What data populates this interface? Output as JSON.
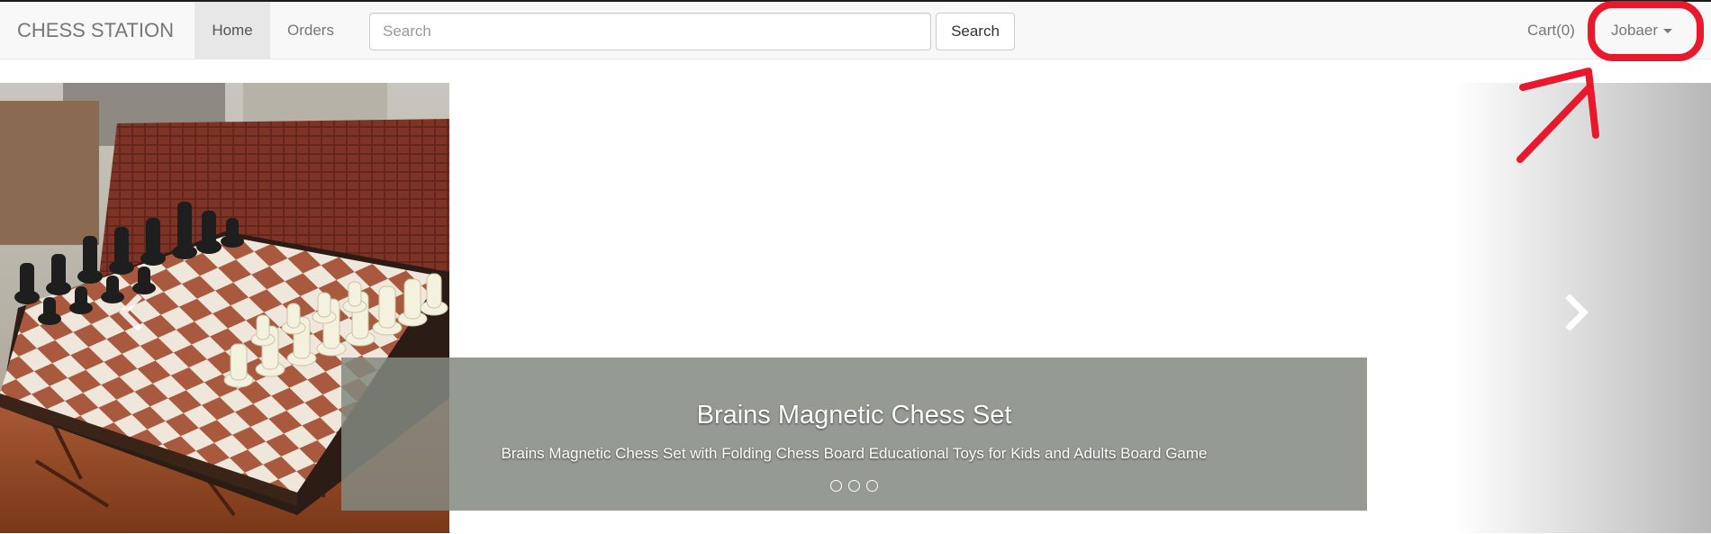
{
  "navbar": {
    "brand": "CHESS STATION",
    "home_label": "Home",
    "orders_label": "Orders",
    "search_placeholder": "Search",
    "search_button_label": "Search",
    "cart_label": "Cart(0)",
    "user_label": "Jobaer"
  },
  "carousel": {
    "caption_title": "Brains Magnetic Chess Set",
    "caption_text": "Brains Magnetic Chess Set with Folding Chess Board Educational Toys for Kids and Adults Board Game",
    "indicator_count": 3,
    "prev_icon": "chevron-left-icon",
    "next_icon": "chevron-right-icon"
  },
  "annotation": {
    "color": "#e8192c",
    "shapes": [
      "highlight-circle",
      "pointer-arrow"
    ]
  },
  "colors": {
    "navbar_bg": "#f8f8f8",
    "nav_text": "#777777",
    "caption_bg": "#828980"
  }
}
